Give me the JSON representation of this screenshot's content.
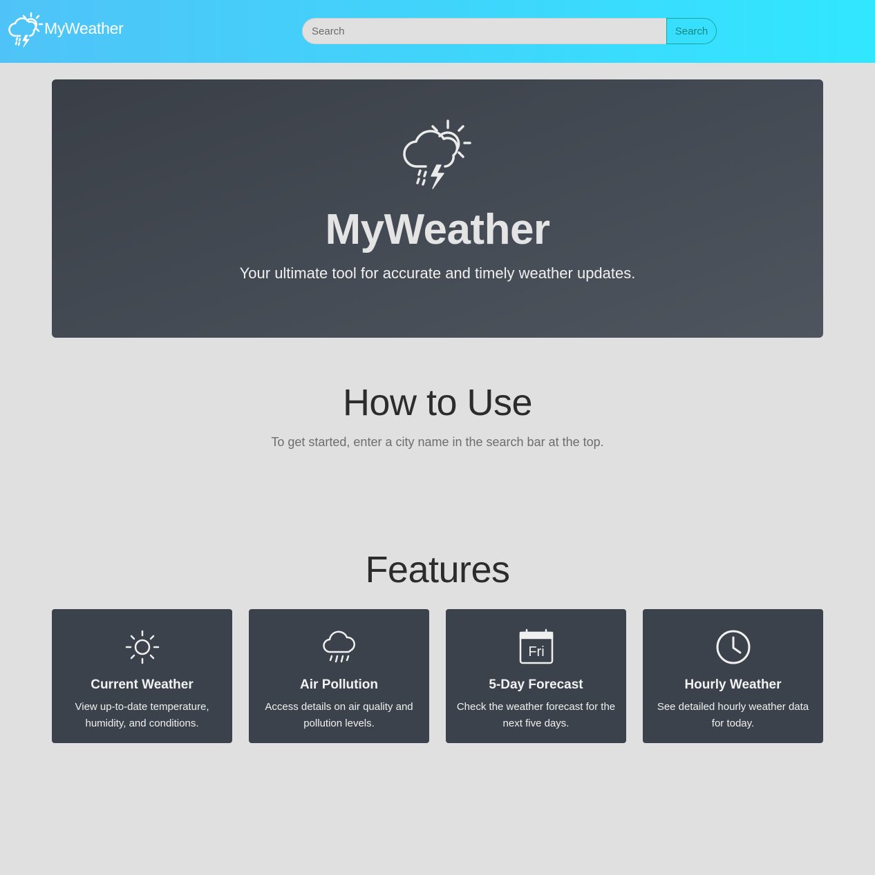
{
  "header": {
    "brand": "MyWeather",
    "brand_icon": "thunderstorm-sun-icon",
    "search_placeholder": "Search",
    "search_button": "Search"
  },
  "hero": {
    "icon": "thunderstorm-sun-icon",
    "title": "MyWeather",
    "subtitle": "Your ultimate tool for accurate and timely weather updates."
  },
  "howto": {
    "title": "How to Use",
    "text": "To get started, enter a city name in the search bar at the top."
  },
  "features": {
    "title": "Features",
    "cards": [
      {
        "icon": "sun-icon",
        "title": "Current Weather",
        "text": "View up-to-date temperature, humidity, and conditions."
      },
      {
        "icon": "rain-cloud-icon",
        "title": "Air Pollution",
        "text": "Access details on air quality and pollution levels."
      },
      {
        "icon": "calendar-fri-icon",
        "title": "5-Day Forecast",
        "text": "Check the weather forecast for the next five days.",
        "icon_label": "Fri"
      },
      {
        "icon": "clock-icon",
        "title": "Hourly Weather",
        "text": "See detailed hourly weather data for today."
      }
    ]
  },
  "colors": {
    "header_gradient_start": "#4fc3f7",
    "header_gradient_end": "#31e7ff",
    "page_background": "#e0e0e0",
    "hero_background": "#444a53",
    "card_background": "#3c424b",
    "search_button_accent": "#1aa59a"
  }
}
